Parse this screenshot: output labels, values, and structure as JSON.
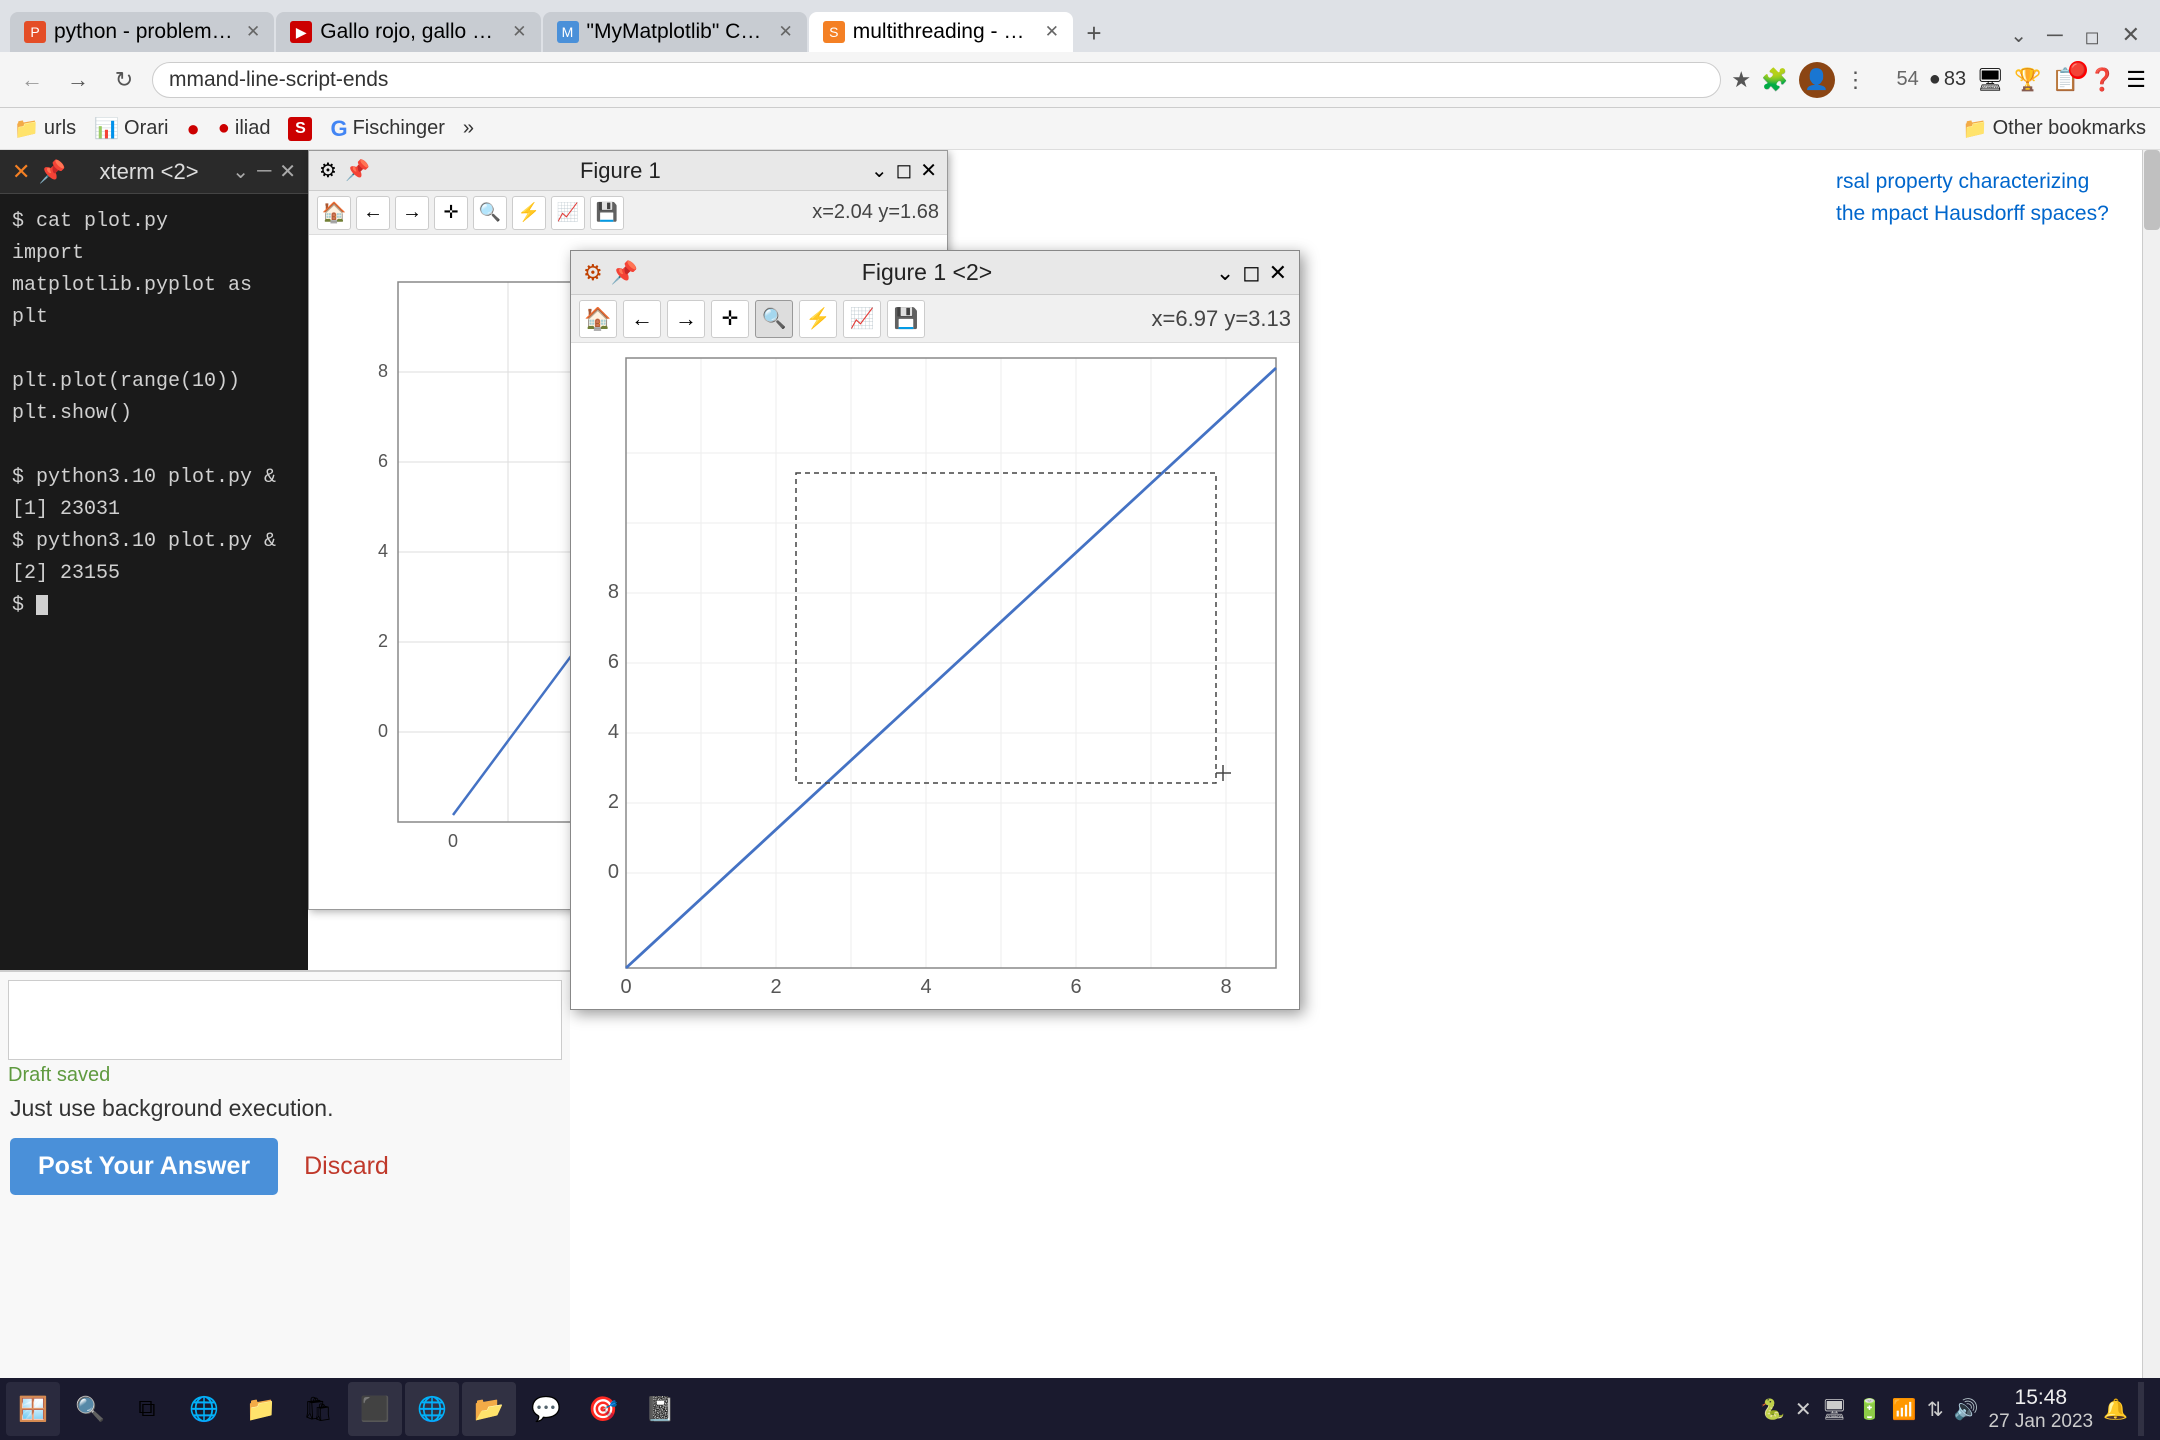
{
  "browser": {
    "tabs": [
      {
        "id": "tab1",
        "title": "python - problem on generati...",
        "favicon_color": "#e44d26",
        "active": false
      },
      {
        "id": "tab2",
        "title": "Gallo rojo, gallo negro | Silvia...",
        "favicon_color": "#cc0000",
        "active": false
      },
      {
        "id": "tab3",
        "title": "\"MyMatplotlib\" Custom Filtere...",
        "favicon_color": "#4a90d9",
        "active": false
      },
      {
        "id": "tab4",
        "title": "multithreading - Python Matp...",
        "favicon_color": "#f48024",
        "active": true
      }
    ],
    "address": "mmand-line-script-ends",
    "nav_icons": [
      "←",
      "→",
      "↺"
    ]
  },
  "bookmarks": [
    {
      "label": "urls",
      "icon": "📁"
    },
    {
      "label": "Orari",
      "icon": "📊",
      "color": "#2ecc71"
    },
    {
      "label": "",
      "icon": "🔴",
      "has_icon": true
    },
    {
      "label": "iliad",
      "icon": "🔴"
    },
    {
      "label": "",
      "icon": "S",
      "color": "#cc0000"
    },
    {
      "label": "Fischinger",
      "icon": "G",
      "color": "#4285f4"
    },
    {
      "label": "»",
      "icon": ""
    },
    {
      "label": "Other bookmarks",
      "icon": "📁"
    }
  ],
  "terminal": {
    "lines": [
      "$ cat plot.py",
      "import matplotlib.pyplot as plt",
      "",
      "plt.plot(range(10))",
      "plt.show()",
      "",
      "$ python3.10 plot.py &",
      "[1] 23031",
      "$ python3.10 plot.py &",
      "[2] 23155",
      "$ "
    ]
  },
  "figure1": {
    "title": "Figure 1",
    "coord": "x=2.04 y=1.68",
    "toolbar_icons": [
      "🏠",
      "←",
      "→",
      "✛",
      "🔍",
      "⚡",
      "📈",
      "💾"
    ]
  },
  "figure2": {
    "title": "Figure 1 <2>",
    "coord": "x=6.97 y=3.13",
    "toolbar_icons": [
      "🏠",
      "←",
      "→",
      "✛",
      "🔍",
      "⚡",
      "📈",
      "💾"
    ],
    "active_tool": "🔍"
  },
  "answer_editor": {
    "status": "Draft saved",
    "content": "Just use background execution.",
    "post_button": "Post Your Answer",
    "discard_button": "Discard"
  },
  "right_sidebar": {
    "text": "rsal property characterizing the\nmpact Hausdorff spaces?"
  },
  "toolbar_header": {
    "icons_right": [
      "54",
      "83",
      "🖥",
      "🏆",
      "📋",
      "🔴",
      "❓",
      "☰"
    ]
  },
  "taskbar": {
    "time": "15:48",
    "date": "27 Jan 2023",
    "tray_icons": [
      "🔊",
      "📶",
      "🔋"
    ]
  }
}
